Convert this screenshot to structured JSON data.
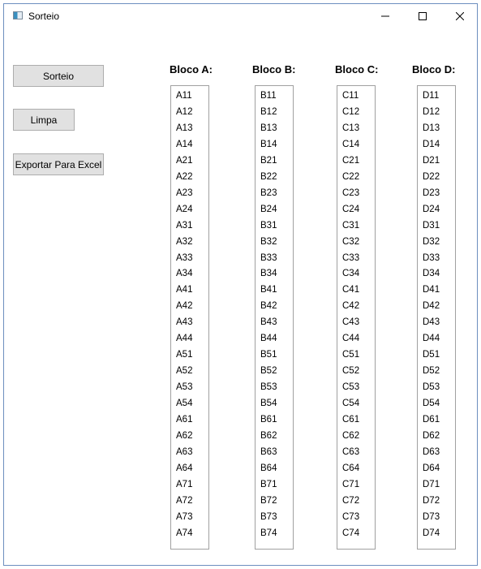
{
  "window": {
    "title": "Sorteio",
    "icon": "app-window-icon"
  },
  "controls": {
    "minimize": "minimize-icon",
    "maximize": "maximize-icon",
    "close": "close-icon"
  },
  "buttons": {
    "sorteio": "Sorteio",
    "limpa": "Limpa",
    "exportar": "Exportar Para Excel"
  },
  "blocks": [
    {
      "header": "Bloco A:",
      "items": [
        "A11",
        "A12",
        "A13",
        "A14",
        "A21",
        "A22",
        "A23",
        "A24",
        "A31",
        "A32",
        "A33",
        "A34",
        "A41",
        "A42",
        "A43",
        "A44",
        "A51",
        "A52",
        "A53",
        "A54",
        "A61",
        "A62",
        "A63",
        "A64",
        "A71",
        "A72",
        "A73",
        "A74"
      ]
    },
    {
      "header": "Bloco B:",
      "items": [
        "B11",
        "B12",
        "B13",
        "B14",
        "B21",
        "B22",
        "B23",
        "B24",
        "B31",
        "B32",
        "B33",
        "B34",
        "B41",
        "B42",
        "B43",
        "B44",
        "B51",
        "B52",
        "B53",
        "B54",
        "B61",
        "B62",
        "B63",
        "B64",
        "B71",
        "B72",
        "B73",
        "B74"
      ]
    },
    {
      "header": "Bloco C:",
      "items": [
        "C11",
        "C12",
        "C13",
        "C14",
        "C21",
        "C22",
        "C23",
        "C24",
        "C31",
        "C32",
        "C33",
        "C34",
        "C41",
        "C42",
        "C43",
        "C44",
        "C51",
        "C52",
        "C53",
        "C54",
        "C61",
        "C62",
        "C63",
        "C64",
        "C71",
        "C72",
        "C73",
        "C74"
      ]
    },
    {
      "header": "Bloco D:",
      "items": [
        "D11",
        "D12",
        "D13",
        "D14",
        "D21",
        "D22",
        "D23",
        "D24",
        "D31",
        "D32",
        "D33",
        "D34",
        "D41",
        "D42",
        "D43",
        "D44",
        "D51",
        "D52",
        "D53",
        "D54",
        "D61",
        "D62",
        "D63",
        "D64",
        "D71",
        "D72",
        "D73",
        "D74"
      ]
    }
  ]
}
